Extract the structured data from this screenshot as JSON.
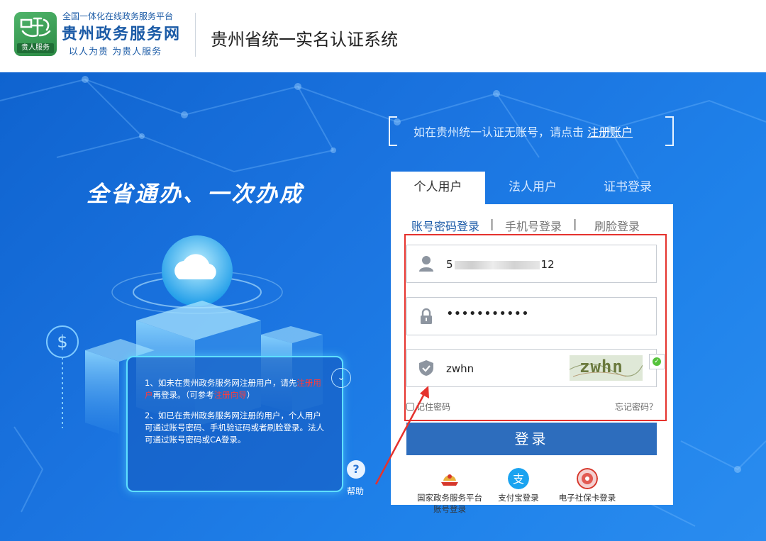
{
  "header": {
    "logo_badge": "贵人服务",
    "brand_sub": "全国一体化在线政务服务平台",
    "brand_name": "贵州政务服务网",
    "brand_slogan": "以人为贵  为贵人服务",
    "system_title": "贵州省统一实名认证系统"
  },
  "hero": {
    "slogan": "全省通办、一次办成",
    "tips": {
      "p1_a": "1、如未在贵州政务服务网注册用户，请先",
      "p1_link1": "注册用户",
      "p1_b": "再登录。（可参考",
      "p1_link2": "注册向导",
      "p1_c": "）",
      "p2": "2、如已在贵州政务服务网注册的用户，个人用户可通过账号密码、手机验证码或者刷脸登录。法人可通过账号密码或CA登录。"
    },
    "help_label": "帮助"
  },
  "register_hint": {
    "text": "如在贵州统一认证无账号，请点击 ",
    "link": "注册账户"
  },
  "tabs": [
    "个人用户",
    "法人用户",
    "证书登录"
  ],
  "login_modes": [
    "账号密码登录",
    "手机号登录",
    "刷脸登录"
  ],
  "form": {
    "username_prefix": "5",
    "username_suffix": "12",
    "password": "•••••••••••",
    "captcha_value": "zwhn",
    "captcha_image_text": "zwhn",
    "remember": "记住密码",
    "forgot": "忘记密码？",
    "login_button": "登录"
  },
  "alt_logins": [
    {
      "label": "国家政务服务平台账号登录",
      "icon": "national-emblem-icon"
    },
    {
      "label": "支付宝登录",
      "icon": "alipay-icon"
    },
    {
      "label": "电子社保卡登录",
      "icon": "social-security-icon"
    }
  ],
  "colors": {
    "primary": "#2d6dbd",
    "highlight": "#e5322d",
    "hero_bg": "#1b74e0"
  }
}
